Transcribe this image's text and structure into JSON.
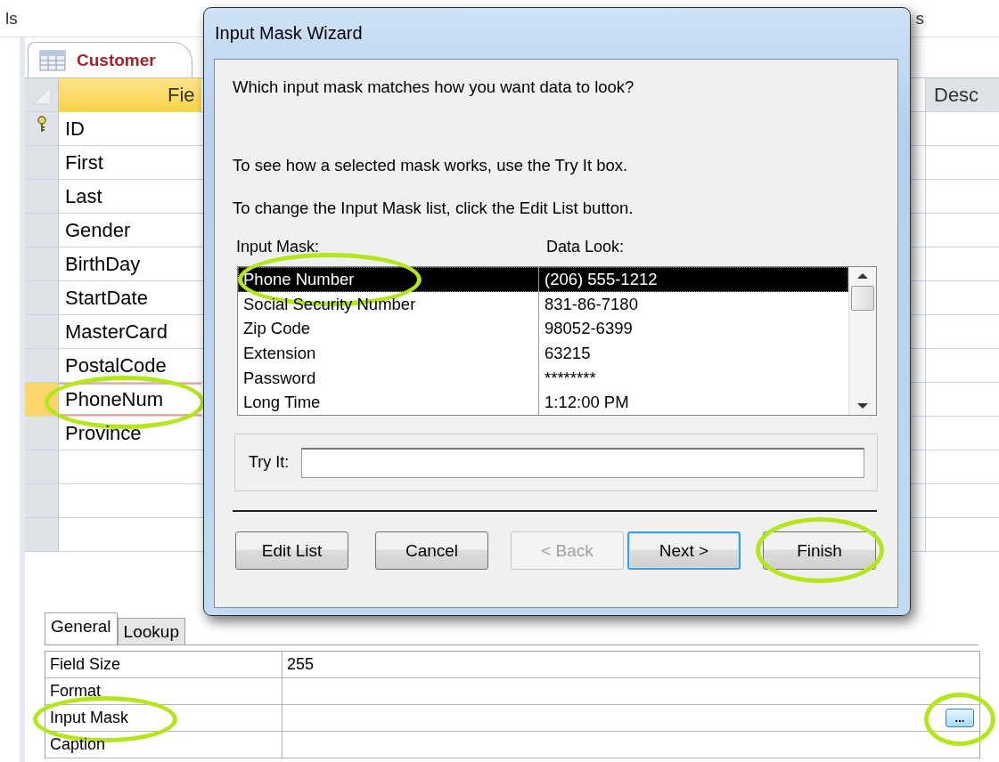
{
  "ribbon_fragments": [
    {
      "text": "ls"
    },
    {
      "text": "s"
    }
  ],
  "document_tab": {
    "label": "Customer",
    "selected": true
  },
  "table": {
    "columns": [
      "Fie",
      "Desc"
    ],
    "rows": [
      {
        "field_name": "ID",
        "primary_key": true,
        "selected": false,
        "highlighted": false
      },
      {
        "field_name": "First",
        "primary_key": false,
        "selected": false,
        "highlighted": false
      },
      {
        "field_name": "Last",
        "primary_key": false,
        "selected": false,
        "highlighted": false
      },
      {
        "field_name": "Gender",
        "primary_key": false,
        "selected": false,
        "highlighted": false
      },
      {
        "field_name": "BirthDay",
        "primary_key": false,
        "selected": false,
        "highlighted": false
      },
      {
        "field_name": "StartDate",
        "primary_key": false,
        "selected": false,
        "highlighted": false
      },
      {
        "field_name": "MasterCard",
        "primary_key": false,
        "selected": false,
        "highlighted": false
      },
      {
        "field_name": "PostalCode",
        "primary_key": false,
        "selected": false,
        "highlighted": false
      },
      {
        "field_name": "PhoneNum",
        "primary_key": false,
        "selected": true,
        "highlighted": true
      },
      {
        "field_name": "Province",
        "primary_key": false,
        "selected": false,
        "highlighted": false
      }
    ]
  },
  "property_tabs": [
    {
      "label": "General",
      "selected": true
    },
    {
      "label": "Lookup",
      "selected": false
    }
  ],
  "properties": [
    {
      "label": "Field Size",
      "value": "255",
      "highlighted": false
    },
    {
      "label": "Format",
      "highlighted": false
    },
    {
      "label": "Input Mask",
      "highlighted": true,
      "builder": {
        "label": "...",
        "highlighted": true
      }
    },
    {
      "label": "Caption",
      "highlighted": false
    }
  ],
  "dialog": {
    "title": "Input Mask Wizard",
    "prompt": "Which input mask matches how you want data to look?",
    "instructions": [
      "To see how a selected mask works, use the Try It box.",
      "To change the Input Mask list, click the Edit List button."
    ],
    "list": {
      "columns": [
        "Input Mask:",
        "Data Look:"
      ],
      "rows": [
        {
          "mask": "Phone Number",
          "look": "(206) 555-1212",
          "selected": true,
          "highlighted": true
        },
        {
          "mask": "Social Security Number",
          "look": "831-86-7180",
          "selected": false,
          "highlighted": false
        },
        {
          "mask": "Zip Code",
          "look": "98052-6399",
          "selected": false,
          "highlighted": false
        },
        {
          "mask": "Extension",
          "look": "63215",
          "selected": false,
          "highlighted": false
        },
        {
          "mask": "Password",
          "look": "********",
          "selected": false,
          "highlighted": false
        },
        {
          "mask": "Long Time",
          "look": "1:12:00 PM",
          "selected": false,
          "highlighted": false
        }
      ]
    },
    "try_it": {
      "label": "Try It:"
    },
    "buttons": [
      {
        "label": "Edit List",
        "disabled": false,
        "default": false,
        "highlighted": false
      },
      {
        "label": "Cancel",
        "disabled": false,
        "default": false,
        "highlighted": false
      },
      {
        "label": "< Back",
        "disabled": true,
        "default": false,
        "highlighted": false
      },
      {
        "label": "Next >",
        "disabled": false,
        "default": true,
        "highlighted": false
      },
      {
        "label": "Finish",
        "disabled": false,
        "default": false,
        "highlighted": true
      }
    ]
  }
}
